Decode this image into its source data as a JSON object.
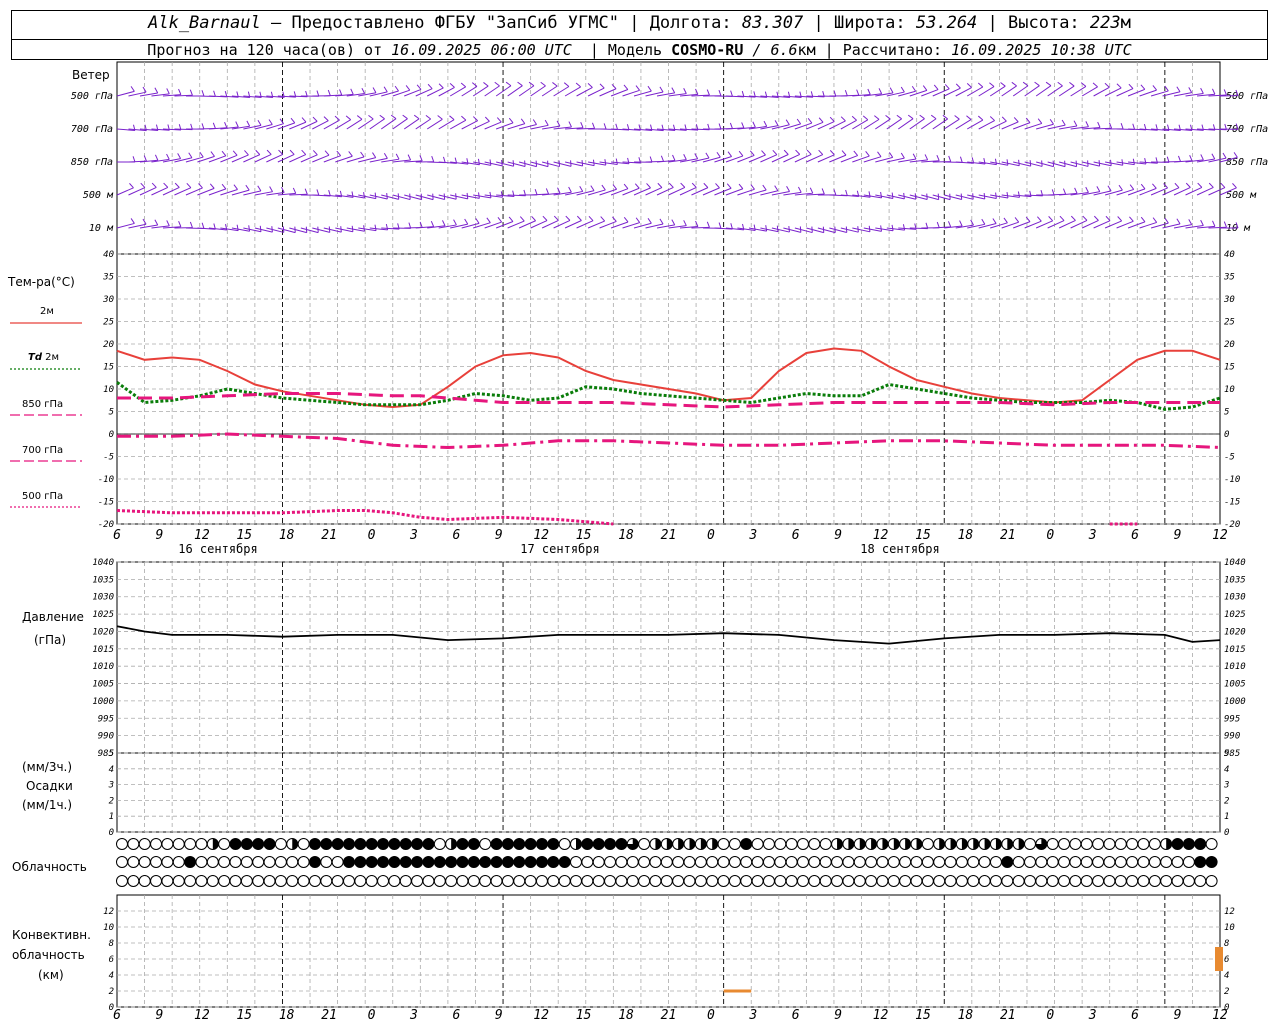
{
  "header": {
    "station": "Alk_Barnaul",
    "dash": "–",
    "provider": "Предоставлено ФГБУ \"ЗапСиб УГМС\"",
    "lon_label": "Долгота:",
    "lon_value": "83.307",
    "lat_label": "Широта:",
    "lat_value": "53.264",
    "alt_label": "Высота:",
    "alt_value": "223",
    "alt_unit": "м",
    "forecast_prefix": "Прогноз на 120 часа(ов) от",
    "forecast_time": "16.09.2025 06:00 UTC",
    "model_label": "Модель",
    "model_name": "COSMO-RU",
    "model_res": "/ 6.6",
    "model_res_unit": "км",
    "calc_label": "Рассчитано:",
    "calc_time": "16.09.2025 10:38 UTC"
  },
  "labels": {
    "wind": "Ветер",
    "temp": "Тем-ра(°C)",
    "t2m": "2м",
    "td_italic": "Td",
    "td2m": "2м",
    "t850": "850 гПа",
    "t700": "700 гПа",
    "t500": "500 гПа",
    "pressure": "Давление",
    "pressure_unit": "(гПа)",
    "precip3": "(мм/3ч.)",
    "precip": "Осадки",
    "precip1": "(мм/1ч.)",
    "cloud": "Облачность",
    "conv1": "Конвективн.",
    "conv2": "облачность",
    "conv3": "(км)"
  },
  "dates": [
    "16 сентября",
    "17 сентября",
    "18 сентября"
  ],
  "colors": {
    "t2m": "#e8403a",
    "td": "#0a7d0a",
    "t850": "#e6167d",
    "t700": "#e6167d",
    "t500": "#e6167d",
    "wind": "#7a22cc",
    "pressure": "#000000",
    "convective": "#e88a30"
  },
  "chart_data": [
    {
      "type": "wind-barbs",
      "levels": [
        "500 гПа",
        "700 гПа",
        "850 гПа",
        "500 м",
        "10  м"
      ]
    },
    {
      "type": "line",
      "x_ticks": [
        "6",
        "9",
        "12",
        "15",
        "18",
        "21",
        "0",
        "3",
        "6",
        "9",
        "12",
        "15",
        "18",
        "21",
        "0",
        "3",
        "6",
        "9",
        "12",
        "15",
        "18",
        "21",
        "0",
        "3",
        "6",
        "9",
        "12"
      ],
      "x_hours": [
        0,
        120
      ],
      "ylim": [
        -20,
        40
      ],
      "y_ticks": [
        -20,
        -15,
        -10,
        -5,
        0,
        5,
        10,
        15,
        20,
        25,
        30,
        35,
        40
      ],
      "series": [
        {
          "name": "2м",
          "style": "solid",
          "x": [
            0,
            3,
            6,
            9,
            12,
            15,
            18,
            21,
            24,
            27,
            30,
            33,
            36,
            39,
            42,
            45,
            48,
            51,
            54,
            57,
            60,
            63,
            66,
            69,
            72,
            75,
            78,
            81,
            84,
            87,
            90,
            93,
            96,
            99,
            102,
            105,
            108,
            111,
            114,
            117,
            120
          ],
          "values": [
            18.5,
            16.5,
            17,
            16.5,
            14,
            11,
            9.5,
            8.5,
            7.5,
            6.5,
            6,
            6.5,
            10.5,
            15,
            17.5,
            18,
            17,
            14,
            12,
            11,
            10,
            9,
            7.5,
            8,
            14,
            18,
            19,
            18.5,
            15,
            12,
            10.5,
            9,
            8,
            7.5,
            7,
            7.5,
            12,
            16.5,
            18.5,
            18.5,
            16.5
          ]
        },
        {
          "name": "Td 2м",
          "style": "dotted",
          "x": [
            0,
            3,
            6,
            9,
            12,
            15,
            18,
            21,
            24,
            27,
            30,
            33,
            36,
            39,
            42,
            45,
            48,
            51,
            54,
            57,
            60,
            63,
            66,
            69,
            72,
            75,
            78,
            81,
            84,
            87,
            90,
            93,
            96,
            99,
            102,
            105,
            108,
            111,
            114,
            117,
            120
          ],
          "values": [
            11.5,
            7,
            7.5,
            8.5,
            10,
            9,
            8,
            7.5,
            7,
            6.5,
            6.5,
            6.5,
            7.5,
            9,
            8.5,
            7.5,
            8,
            10.5,
            10,
            9,
            8.5,
            8,
            7.5,
            7,
            8,
            9,
            8.5,
            8.5,
            11,
            10,
            9,
            8,
            7.5,
            7,
            7,
            7,
            7.5,
            7,
            5.5,
            6,
            8
          ]
        },
        {
          "name": "850 гПа",
          "style": "dashed",
          "x": [
            0,
            6,
            12,
            18,
            24,
            30,
            33,
            36,
            42,
            48,
            54,
            60,
            66,
            72,
            78,
            84,
            90,
            96,
            102,
            108,
            114,
            120
          ],
          "values": [
            8,
            8,
            8.5,
            9,
            9,
            8.5,
            8.5,
            8,
            7,
            7,
            7,
            6.5,
            6,
            6.5,
            7,
            7,
            7,
            7,
            6.5,
            7,
            7,
            7
          ]
        },
        {
          "name": "700 гПа",
          "style": "dashdot",
          "x": [
            0,
            6,
            12,
            18,
            24,
            30,
            36,
            42,
            48,
            54,
            60,
            66,
            72,
            78,
            84,
            90,
            96,
            102,
            108,
            114,
            120
          ],
          "values": [
            -0.5,
            -0.5,
            0,
            -0.5,
            -1,
            -2.5,
            -3,
            -2.5,
            -1.5,
            -1.5,
            -2,
            -2.5,
            -2.5,
            -2,
            -1.5,
            -1.5,
            -2,
            -2.5,
            -2.5,
            -2.5,
            -3
          ]
        },
        {
          "name": "500 гПа",
          "style": "dotted",
          "segments": [
            {
              "x": [
                0,
                6,
                12,
                18,
                24,
                27,
                30,
                33,
                36,
                42,
                48,
                54
              ],
              "values": [
                -17,
                -17.5,
                -17.5,
                -17.5,
                -17,
                -17,
                -17.5,
                -18.5,
                -19,
                -18.5,
                -19,
                -20
              ]
            },
            {
              "x": [
                108,
                111
              ],
              "values": [
                -20,
                -20
              ]
            }
          ]
        }
      ]
    },
    {
      "type": "line",
      "name": "Давление",
      "ylim": [
        985,
        1040
      ],
      "y_ticks": [
        985,
        990,
        995,
        1000,
        1005,
        1010,
        1015,
        1020,
        1025,
        1030,
        1035,
        1040
      ],
      "x": [
        0,
        3,
        6,
        9,
        12,
        18,
        24,
        30,
        36,
        42,
        48,
        54,
        60,
        66,
        72,
        78,
        84,
        90,
        96,
        102,
        108,
        114,
        117,
        120
      ],
      "values": [
        1021.5,
        1020,
        1019,
        1019,
        1019,
        1018.5,
        1019,
        1019,
        1017.5,
        1018,
        1019,
        1019,
        1019,
        1019.5,
        1019,
        1017.5,
        1016.5,
        1018,
        1019,
        1019,
        1019.5,
        1019,
        1017,
        1017.5
      ]
    },
    {
      "type": "bar",
      "name": "Осадки",
      "ylim": [
        0,
        5
      ],
      "y_ticks": [
        0,
        1,
        2,
        3,
        4,
        5
      ],
      "values": []
    },
    {
      "type": "cloud-symbols",
      "name": "Облачность",
      "rows": 3,
      "per_row": 97
    },
    {
      "type": "bar",
      "name": "Конвективн. облачность",
      "ylim": [
        0,
        14
      ],
      "y_ticks": [
        0,
        2,
        4,
        6,
        8,
        10,
        12
      ],
      "segments": [
        {
          "x": [
            66,
            69
          ],
          "y": 2
        },
        {
          "x": [
            120,
            120
          ],
          "y": [
            4.5,
            7.5
          ]
        }
      ]
    }
  ]
}
